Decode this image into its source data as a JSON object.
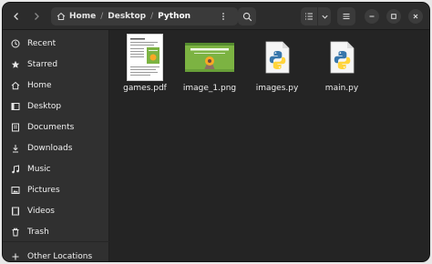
{
  "header": {
    "path": [
      "Home",
      "Desktop",
      "Python"
    ]
  },
  "sidebar": {
    "items": [
      {
        "label": "Recent",
        "icon": "clock-icon"
      },
      {
        "label": "Starred",
        "icon": "star-icon"
      },
      {
        "label": "Home",
        "icon": "home-icon"
      },
      {
        "label": "Desktop",
        "icon": "desktop-icon"
      },
      {
        "label": "Documents",
        "icon": "document-icon"
      },
      {
        "label": "Downloads",
        "icon": "download-icon"
      },
      {
        "label": "Music",
        "icon": "music-icon"
      },
      {
        "label": "Pictures",
        "icon": "picture-icon"
      },
      {
        "label": "Videos",
        "icon": "video-icon"
      },
      {
        "label": "Trash",
        "icon": "trash-icon"
      },
      {
        "label": "Other Locations",
        "icon": "plus-icon"
      }
    ]
  },
  "files": [
    {
      "name": "games.pdf",
      "type": "pdf"
    },
    {
      "name": "image_1.png",
      "type": "image"
    },
    {
      "name": "images.py",
      "type": "python"
    },
    {
      "name": "main.py",
      "type": "python"
    }
  ],
  "colors": {
    "window_bg": "#242424",
    "sidebar_bg": "#303030",
    "headerbar_bg": "#2c2c2c",
    "python_blue": "#3776ab",
    "python_yellow": "#ffd43b",
    "thumb_green": "#7cb342"
  }
}
